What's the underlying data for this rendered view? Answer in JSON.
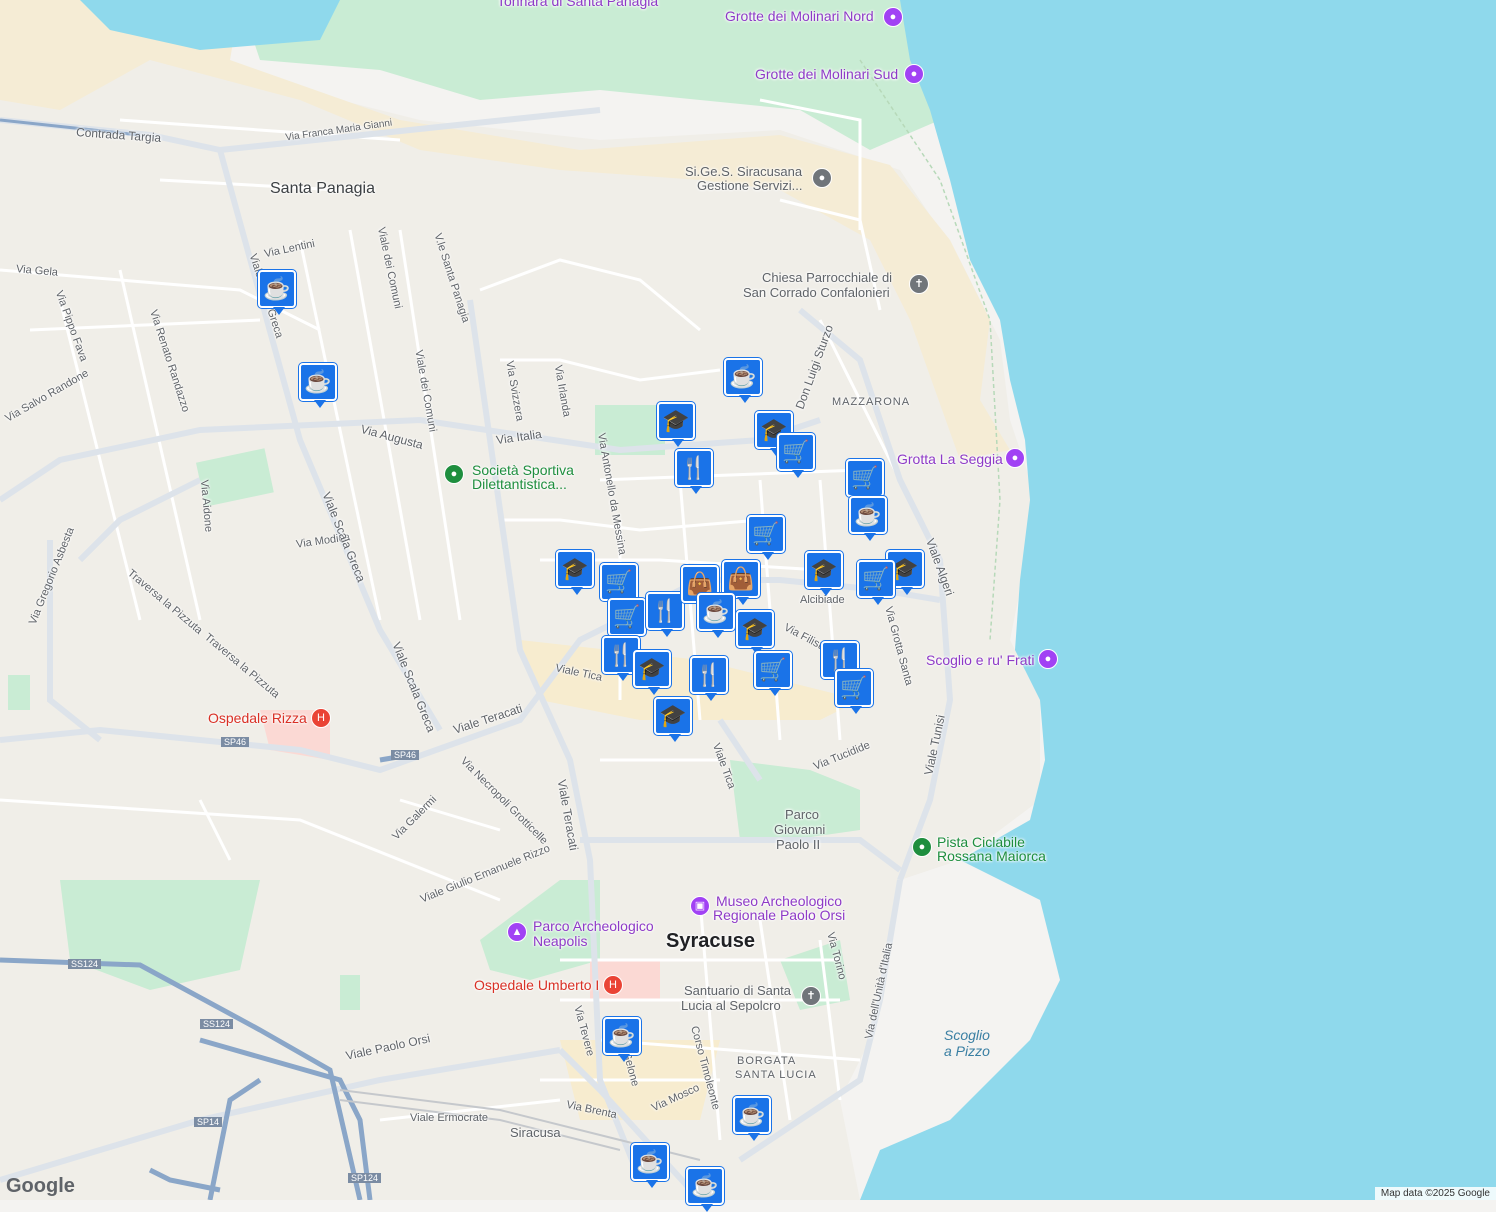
{
  "colors": {
    "water": "#8fd9ec",
    "land": "#f4f3f1",
    "park": "#c9ecd4",
    "sand": "#f5ecd5",
    "road": "#ffffff",
    "highway": "#8aa6c8",
    "marker": "#1a73e8"
  },
  "places": {
    "top_poi": "Tonnara di Santa Panagia",
    "grotte_nord": "Grotte dei Molinari Nord",
    "grotte_sud": "Grotte dei Molinari Sud",
    "sigess_1": "Si.Ge.S. Siracusana",
    "sigess_2": "Gestione Servizi...",
    "chiesa_1": "Chiesa Parrocchiale di",
    "chiesa_2": "San Corrado Confalonieri",
    "mazzarona": "MAZZARONA",
    "grotta_seggia": "Grotta La Seggia",
    "societa_1": "Società Sportiva",
    "societa_2": "Dilettantistica...",
    "scoglio_frati": "Scoglio e ru' Frati",
    "santa_panagia": "Santa Panagia",
    "ospedale_rizza": "Ospedale Rizza",
    "parco_gp_1": "Parco",
    "parco_gp_2": "Giovanni",
    "parco_gp_3": "Paolo II",
    "pista_1": "Pista Ciclabile",
    "pista_2": "Rossana Maiorca",
    "museo_1": "Museo Archeologico",
    "museo_2": "Regionale Paolo Orsi",
    "parco_neapolis_1": "Parco Archeologico",
    "parco_neapolis_2": "Neapolis",
    "syracuse": "Syracuse",
    "ospedale_umberto": "Ospedale Umberto I",
    "santuario_1": "Santuario di Santa",
    "santuario_2": "Lucia al Sepolcro",
    "borgata_1": "BORGATA",
    "borgata_2": "SANTA LUCIA",
    "scoglio_pizzo_1": "Scoglio",
    "scoglio_pizzo_2": "a Pizzo",
    "siracusa_station": "Siracusa"
  },
  "streets": {
    "contrada_targia": "Contrada Targia",
    "via_franca": "Via Franca Maria Gianni",
    "via_gela": "Via Gela",
    "via_lentini": "Via Lentini",
    "viale_scala_greca_top": "Viale Scala Greca",
    "viale_dei_comuni": "Viale dei Comuni",
    "vle_santa_panagia": "V.le Santa Panagia",
    "via_pippo_fava": "Via Pippo Fava",
    "via_renato": "Via Renato Randazzo",
    "via_salvo": "Via Salvo Randone",
    "via_svizzera": "Via Svizzera",
    "via_irlanda": "Via Irlanda",
    "via_augusta": "Via Augusta",
    "via_italia": "Via Italia",
    "via_antonello": "Via Antonello da Messina",
    "via_don_luigi": "Don Luigi Sturzo",
    "via_aidone": "Via Aidone",
    "via_modica": "Via Modica",
    "via_gregorio": "Via Gregorio Asbesta",
    "traversa_pizzuta": "Traversa la Pizzuta",
    "viale_scala_greca": "Viale Scala Greca",
    "viale_teracati": "Viale Teracati",
    "viale_tica": "Viale Tica",
    "via_grotta_santa": "Via Grotta Santa",
    "viale_algeri": "Viale Algeri",
    "viale_tunisi": "Viale Tunisi",
    "via_tucidide": "Via Tucidide",
    "via_alcibiade": "Alcibiade",
    "via_filisto": "Via Filisto",
    "via_necropoli": "Via Necropoli Grotticelle",
    "via_galermi": "Via Galermi",
    "viale_giulio": "Viale Giulio Emanuele Rizzo",
    "viale_paolo_orsi": "Viale Paolo Orsi",
    "via_torino": "Via Torino",
    "viale_unita": "Via dell'Unità d'Italia",
    "corso_timoleonte": "Corso Timoleonte",
    "via_mosco": "Via Mosco",
    "via_brenta": "Via Brenta",
    "viale_ermocrate": "Viale Ermocrate",
    "via_tevere": "Via Tevere",
    "via_gelone": "Gelone",
    "sp46": "SP46",
    "ss124": "SS124",
    "sp14": "SP14",
    "sp124": "SP124"
  },
  "markers": [
    {
      "type": "cafe",
      "icon": "☕"
    },
    {
      "type": "cafe",
      "icon": "☕"
    },
    {
      "type": "cafe",
      "icon": "☕"
    },
    {
      "type": "school",
      "icon": "🎓"
    },
    {
      "type": "school",
      "icon": "🎓"
    },
    {
      "type": "shop",
      "icon": "🛒"
    },
    {
      "type": "restaurant",
      "icon": "🍴"
    },
    {
      "type": "shop",
      "icon": "🛒"
    },
    {
      "type": "cafe",
      "icon": "☕"
    },
    {
      "type": "shop",
      "icon": "🛒"
    },
    {
      "type": "school",
      "icon": "🎓"
    },
    {
      "type": "school",
      "icon": "🎓"
    },
    {
      "type": "shop",
      "icon": "🛒"
    },
    {
      "type": "school",
      "icon": "🎓"
    },
    {
      "type": "shop",
      "icon": "🛒"
    },
    {
      "type": "shop",
      "icon": "🛒"
    },
    {
      "type": "restaurant",
      "icon": "🍴"
    },
    {
      "type": "bag",
      "icon": "👜"
    },
    {
      "type": "bag",
      "icon": "👜"
    },
    {
      "type": "cafe",
      "icon": "☕"
    },
    {
      "type": "school",
      "icon": "🎓"
    },
    {
      "type": "restaurant",
      "icon": "🍴"
    },
    {
      "type": "school",
      "icon": "🎓"
    },
    {
      "type": "restaurant",
      "icon": "🍴"
    },
    {
      "type": "shop",
      "icon": "🛒"
    },
    {
      "type": "school",
      "icon": "🎓"
    },
    {
      "type": "restaurant",
      "icon": "🍴"
    },
    {
      "type": "shop",
      "icon": "🛒"
    },
    {
      "type": "cafe",
      "icon": "☕"
    },
    {
      "type": "cafe",
      "icon": "☕"
    },
    {
      "type": "cafe",
      "icon": "☕"
    },
    {
      "type": "cafe",
      "icon": "☕"
    }
  ],
  "footer": {
    "attribution": "Map data ©2025 Google",
    "logo": "Google"
  }
}
